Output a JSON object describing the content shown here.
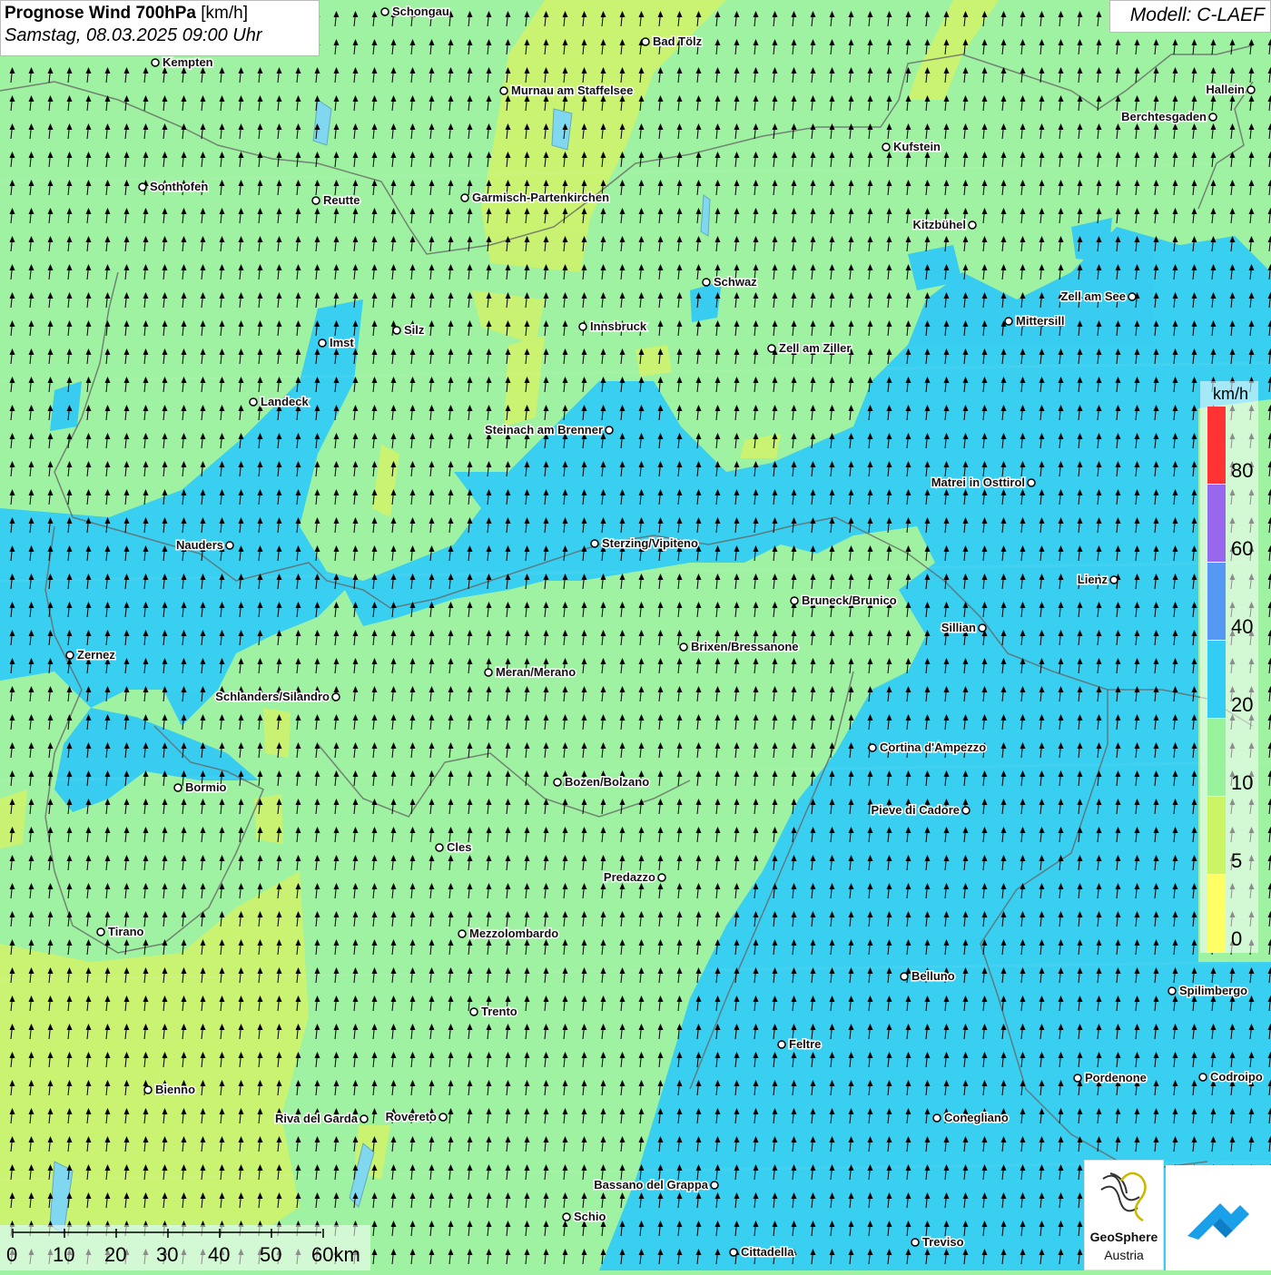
{
  "header": {
    "title_bold": "Prognose Wind 700hPa",
    "title_unit": " [km/h]",
    "datetime": "Samstag, 08.03.2025 09:00 Uhr",
    "model": "Modell: C-LAEF"
  },
  "legend": {
    "unit": "km/h",
    "bins": [
      {
        "from": 0,
        "to": 5,
        "color": "#ffff66",
        "label": "0"
      },
      {
        "from": 5,
        "to": 10,
        "color": "#ccf566",
        "label": "5"
      },
      {
        "from": 10,
        "to": 20,
        "color": "#99f29c",
        "label": "10"
      },
      {
        "from": 20,
        "to": 40,
        "color": "#33ccf5",
        "label": "20"
      },
      {
        "from": 40,
        "to": 60,
        "color": "#5599f5",
        "label": "40"
      },
      {
        "from": 60,
        "to": 80,
        "color": "#9966ee",
        "label": "60"
      },
      {
        "from": 80,
        "to": 100,
        "color": "#ff3333",
        "label": "80"
      }
    ]
  },
  "scalebar": {
    "labels": [
      "0",
      "10",
      "20",
      "30",
      "40",
      "50",
      "60km"
    ]
  },
  "wind": {
    "predominant_direction": "south-southwesterly (arrows point north)",
    "arrow_color": "#000000"
  },
  "cities": [
    {
      "name": "Schongau",
      "anchor": "start"
    },
    {
      "name": "Bad Tölz",
      "anchor": "start"
    },
    {
      "name": "Kempten",
      "anchor": "start"
    },
    {
      "name": "Murnau am Staffelsee",
      "anchor": "start"
    },
    {
      "name": "Hallein",
      "anchor": "end"
    },
    {
      "name": "Berchtesgaden",
      "anchor": "end"
    },
    {
      "name": "Kufstein",
      "anchor": "start"
    },
    {
      "name": "Sonthofen",
      "anchor": "start"
    },
    {
      "name": "Reutte",
      "anchor": "start"
    },
    {
      "name": "Garmisch-Partenkirchen",
      "anchor": "start"
    },
    {
      "name": "Kitzbühel",
      "anchor": "end"
    },
    {
      "name": "Schwaz",
      "anchor": "start"
    },
    {
      "name": "Zell am See",
      "anchor": "end"
    },
    {
      "name": "Innsbruck",
      "anchor": "start"
    },
    {
      "name": "Silz",
      "anchor": "start"
    },
    {
      "name": "Imst",
      "anchor": "start"
    },
    {
      "name": "Mittersill",
      "anchor": "start"
    },
    {
      "name": "Zell am Ziller",
      "anchor": "start"
    },
    {
      "name": "Landeck",
      "anchor": "start"
    },
    {
      "name": "Steinach am Brenner",
      "anchor": "end"
    },
    {
      "name": "Matrei in Osttirol",
      "anchor": "end"
    },
    {
      "name": "Nauders",
      "anchor": "end"
    },
    {
      "name": "Sterzing/Vipiteno",
      "anchor": "start"
    },
    {
      "name": "Lienz",
      "anchor": "end"
    },
    {
      "name": "Bruneck/Brunico",
      "anchor": "start"
    },
    {
      "name": "Sillian",
      "anchor": "end"
    },
    {
      "name": "Brixen/Bressanone",
      "anchor": "start"
    },
    {
      "name": "Zernez",
      "anchor": "start"
    },
    {
      "name": "Meran/Merano",
      "anchor": "start"
    },
    {
      "name": "Schlanders/Silandro",
      "anchor": "end"
    },
    {
      "name": "Cortina d'Ampezzo",
      "anchor": "start"
    },
    {
      "name": "Bormio",
      "anchor": "start"
    },
    {
      "name": "Bozen/Bolzano",
      "anchor": "start"
    },
    {
      "name": "Pieve di Cadore",
      "anchor": "end"
    },
    {
      "name": "Cles",
      "anchor": "start"
    },
    {
      "name": "Predazzo",
      "anchor": "end"
    },
    {
      "name": "Tirano",
      "anchor": "start"
    },
    {
      "name": "Mezzolombardo",
      "anchor": "start"
    },
    {
      "name": "Belluno",
      "anchor": "start"
    },
    {
      "name": "Spilimbergo",
      "anchor": "start"
    },
    {
      "name": "Trento",
      "anchor": "start"
    },
    {
      "name": "Feltre",
      "anchor": "start"
    },
    {
      "name": "Pordenone",
      "anchor": "start"
    },
    {
      "name": "Codroipo",
      "anchor": "start"
    },
    {
      "name": "Bienno",
      "anchor": "start"
    },
    {
      "name": "Riva del Garda",
      "anchor": "end"
    },
    {
      "name": "Rovereto",
      "anchor": "end"
    },
    {
      "name": "Conegliano",
      "anchor": "start"
    },
    {
      "name": "Bassano del Grappa",
      "anchor": "end"
    },
    {
      "name": "Schio",
      "anchor": "start"
    },
    {
      "name": "Treviso",
      "anchor": "start"
    },
    {
      "name": "Cittadella",
      "anchor": "start"
    }
  ],
  "logos": {
    "geosphere_name": "GeoSphere",
    "geosphere_sub": "Austria"
  }
}
